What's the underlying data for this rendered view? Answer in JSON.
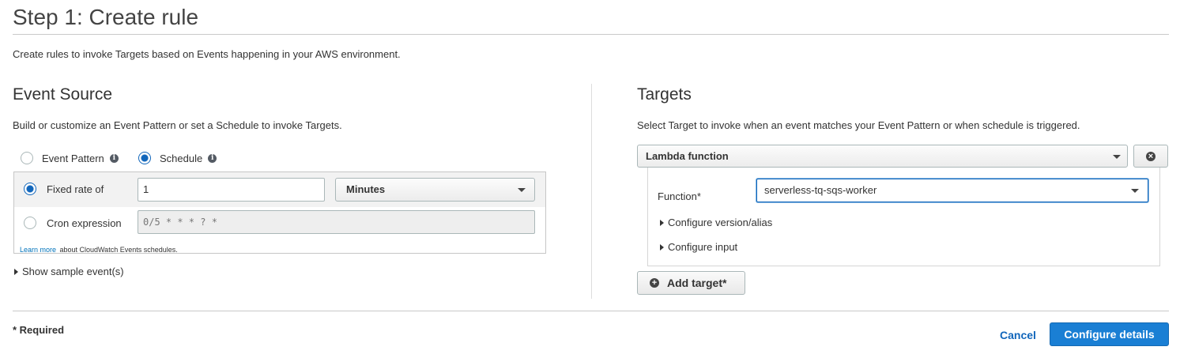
{
  "header": {
    "title": "Step 1: Create rule",
    "subtitle": "Create rules to invoke Targets based on Events happening in your AWS environment."
  },
  "event_source": {
    "heading": "Event Source",
    "description": "Build or customize an Event Pattern or set a Schedule to invoke Targets.",
    "event_pattern_label": "Event Pattern",
    "schedule_label": "Schedule",
    "selected_mode": "Schedule",
    "fixed_rate": {
      "label": "Fixed rate of",
      "value": "1",
      "unit": "Minutes",
      "selected": true
    },
    "cron": {
      "label": "Cron expression",
      "placeholder": "0/5 * * * ? *",
      "selected": false
    },
    "learn_more_link": "Learn more",
    "learn_more_suffix": "about CloudWatch Events schedules.",
    "show_sample": "Show sample event(s)"
  },
  "targets": {
    "heading": "Targets",
    "description": "Select Target to invoke when an event matches your Event Pattern or when schedule is triggered.",
    "target_type": "Lambda function",
    "function_label": "Function*",
    "function_value": "serverless-tq-sqs-worker",
    "configure_version": "Configure version/alias",
    "configure_input": "Configure input",
    "add_target": "Add target*"
  },
  "footer": {
    "required_note": "* Required",
    "cancel": "Cancel",
    "configure_details": "Configure details"
  },
  "colors": {
    "primary": "#1a7fd4",
    "link": "#1166bb",
    "focus": "#1166bb"
  }
}
